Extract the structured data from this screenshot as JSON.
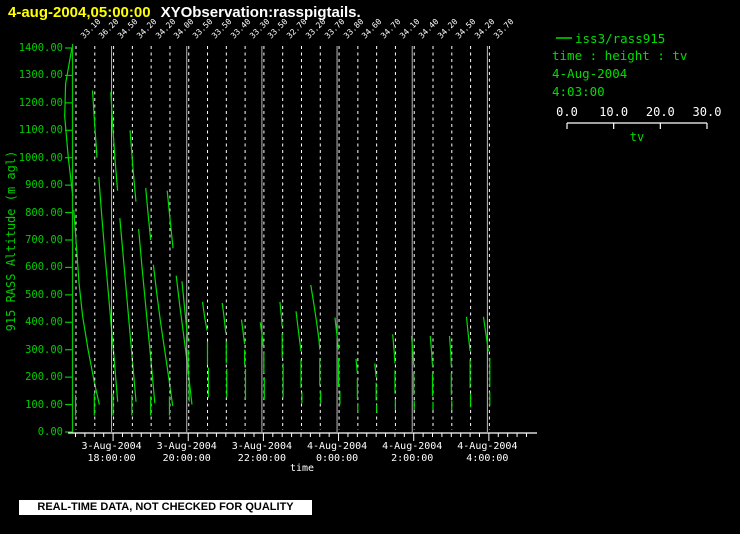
{
  "title": {
    "datetime": "4-aug-2004,05:00:00",
    "name": "XYObservation:rasspigtails."
  },
  "legend": {
    "series_label": "iss3/rass915",
    "relation": "time : height : tv",
    "date": "4-Aug-2004",
    "time": "4:03:00",
    "scale_labels": [
      "0.0",
      "10.0",
      "20.0",
      "30.0"
    ],
    "scale_title": "tv"
  },
  "footer": {
    "warning": "REAL-TIME DATA, NOT CHECKED FOR QUALITY"
  },
  "colors": {
    "background": "#000000",
    "title_datetime": "#ffff00",
    "title_name": "#ffffff",
    "series_green": "#00dd00",
    "axis_green": "#00cc00",
    "grid_gray": "#b8b8b8",
    "dashed_white": "#ffffff",
    "axis_white": "#ffffff",
    "banner_bg": "#ffffff",
    "banner_text": "#000000"
  },
  "chart_data": {
    "type": "line",
    "title": "XYObservation:rasspigtails.",
    "xlabel": "time",
    "ylabel": "915 RASS Altitude (m agl)",
    "ylim": [
      0,
      1400
    ],
    "y_ticks": [
      "1400.00",
      "1300.00",
      "1200.00",
      "1100.00",
      "1000.00",
      "900.00",
      "800.00",
      "700.00",
      "600.00",
      "500.00",
      "400.00",
      "300.00",
      "200.00",
      "100.00",
      "0.00"
    ],
    "x_major_ticks": [
      {
        "line1": "3-Aug-2004",
        "line2": "18:00:00"
      },
      {
        "line1": "3-Aug-2004",
        "line2": "20:00:00"
      },
      {
        "line1": "3-Aug-2004",
        "line2": "22:00:00"
      },
      {
        "line1": "4-Aug-2004",
        "line2": "0:00:00"
      },
      {
        "line1": "4-Aug-2004",
        "line2": "2:00:00"
      },
      {
        "line1": "4-Aug-2004",
        "line2": "4:00:00"
      }
    ],
    "tv_scale": {
      "labels": [
        "0.0",
        "10.0",
        "20.0",
        "30.0"
      ],
      "title": "tv",
      "range": [
        0,
        30
      ]
    },
    "series_note": "each profile: time of sounding, surface tv label shown at top of plot, segments of [tv_offset_units, altitude_m_agl]",
    "profiles": [
      {
        "time": "17:00",
        "label": "33.10",
        "segments": [
          [
            [
              -0.8,
              1400
            ],
            [
              -2.2,
              1270
            ],
            [
              -2.4,
              1150
            ],
            [
              -1.6,
              1000
            ],
            [
              -0.6,
              860
            ]
          ],
          [
            [
              -0.4,
              810
            ],
            [
              0.2,
              680
            ],
            [
              0.8,
              540
            ],
            [
              1.6,
              420
            ],
            [
              2.8,
              300
            ],
            [
              4.2,
              180
            ],
            [
              5.3,
              100
            ]
          ],
          [
            [
              0,
              135
            ],
            [
              0,
              60
            ]
          ]
        ]
      },
      {
        "time": "17:30",
        "label": "36.20",
        "segments": [
          [
            [
              -0.4,
              1245
            ],
            [
              0.1,
              1120
            ],
            [
              0.6,
              1000
            ]
          ],
          [
            [
              1.0,
              930
            ],
            [
              1.6,
              800
            ],
            [
              2.3,
              660
            ],
            [
              3.0,
              530
            ],
            [
              3.7,
              400
            ],
            [
              4.4,
              270
            ],
            [
              5.2,
              110
            ]
          ],
          [
            [
              0,
              140
            ],
            [
              0,
              60
            ]
          ]
        ]
      },
      {
        "time": "18:00",
        "label": "34.50",
        "segments": [
          [
            [
              -0.5,
              1240
            ],
            [
              -0.1,
              1120
            ],
            [
              0.4,
              1000
            ],
            [
              1.0,
              880
            ]
          ],
          [
            [
              1.5,
              780
            ],
            [
              2.2,
              650
            ],
            [
              2.9,
              520
            ],
            [
              3.6,
              390
            ],
            [
              4.3,
              260
            ],
            [
              5.1,
              110
            ]
          ],
          [
            [
              0,
              140
            ],
            [
              0,
              60
            ]
          ]
        ]
      },
      {
        "time": "18:30",
        "label": "34.20",
        "segments": [
          [
            [
              -0.4,
              1100
            ],
            [
              0.2,
              970
            ],
            [
              0.9,
              840
            ]
          ],
          [
            [
              1.5,
              740
            ],
            [
              2.2,
              610
            ],
            [
              2.9,
              490
            ],
            [
              3.6,
              370
            ],
            [
              4.3,
              250
            ],
            [
              5.1,
              105
            ]
          ],
          [
            [
              0,
              135
            ],
            [
              0,
              60
            ]
          ]
        ]
      },
      {
        "time": "19:00",
        "label": "34.20",
        "segments": [
          [
            [
              -1.1,
              890
            ],
            [
              -0.6,
              800
            ],
            [
              0,
              700
            ]
          ],
          [
            [
              0.6,
              610
            ],
            [
              1.4,
              500
            ],
            [
              2.2,
              400
            ],
            [
              3.1,
              300
            ],
            [
              4.0,
              200
            ],
            [
              4.9,
              95
            ]
          ],
          [
            [
              0,
              130
            ],
            [
              0,
              60
            ]
          ]
        ]
      },
      {
        "time": "19:30",
        "label": "34.00",
        "segments": [
          [
            [
              -0.5,
              880
            ],
            [
              0.1,
              780
            ],
            [
              0.8,
              670
            ]
          ],
          [
            [
              1.5,
              570
            ],
            [
              2.3,
              460
            ],
            [
              3.1,
              360
            ],
            [
              3.9,
              260
            ],
            [
              5.0,
              100
            ]
          ],
          [
            [
              0,
              130
            ],
            [
              0,
              60
            ]
          ]
        ]
      },
      {
        "time": "20:00",
        "label": "33.50",
        "segments": [
          [
            [
              -1.4,
              550
            ],
            [
              -0.8,
              450
            ],
            [
              -0.3,
              370
            ],
            [
              0,
              330
            ]
          ],
          [
            [
              0,
              300
            ],
            [
              0,
              210
            ]
          ],
          [
            [
              0.2,
              190
            ],
            [
              0.2,
              110
            ]
          ]
        ]
      },
      {
        "time": "20:30",
        "label": "33.50",
        "segments": [
          [
            [
              -1.0,
              474
            ],
            [
              -0.5,
              415
            ],
            [
              0,
              370
            ]
          ],
          [
            [
              0.1,
              330
            ],
            [
              0.1,
              245
            ]
          ],
          [
            [
              0.3,
              235
            ],
            [
              0.3,
              125
            ]
          ]
        ]
      },
      {
        "time": "21:00",
        "label": "33.40",
        "segments": [
          [
            [
              -0.8,
              470
            ],
            [
              -0.4,
              420
            ],
            [
              0,
              360
            ]
          ],
          [
            [
              0.1,
              330
            ],
            [
              0.1,
              250
            ]
          ],
          [
            [
              0.2,
              230
            ],
            [
              0.2,
              125
            ]
          ]
        ]
      },
      {
        "time": "21:30",
        "label": "33.30",
        "segments": [
          [
            [
              -0.7,
              410
            ],
            [
              -0.3,
              360
            ],
            [
              0,
              320
            ]
          ],
          [
            [
              0,
              300
            ],
            [
              0,
              245
            ]
          ],
          [
            [
              0.2,
              230
            ],
            [
              0.2,
              120
            ]
          ]
        ]
      },
      {
        "time": "22:00",
        "label": "33.50",
        "segments": [
          [
            [
              -0.7,
              400
            ],
            [
              -0.3,
              355
            ],
            [
              0,
              310
            ]
          ],
          [
            [
              0.1,
              290
            ],
            [
              0.1,
              215
            ]
          ],
          [
            [
              0.2,
              200
            ],
            [
              0.2,
              120
            ]
          ]
        ]
      },
      {
        "time": "22:30",
        "label": "32.70",
        "segments": [
          [
            [
              -0.5,
              474
            ],
            [
              -0.2,
              425
            ],
            [
              0,
              385
            ]
          ],
          [
            [
              0,
              360
            ],
            [
              0,
              270
            ]
          ],
          [
            [
              0.2,
              250
            ],
            [
              0.2,
              125
            ]
          ]
        ]
      },
      {
        "time": "23:00",
        "label": "33.20",
        "segments": [
          [
            [
              -1.1,
              440
            ],
            [
              -0.5,
              360
            ],
            [
              0,
              295
            ]
          ],
          [
            [
              0,
              265
            ],
            [
              0,
              160
            ]
          ],
          [
            [
              0.2,
              145
            ],
            [
              0.2,
              105
            ]
          ]
        ]
      },
      {
        "time": "23:30",
        "label": "33.70",
        "segments": [
          [
            [
              -2.0,
              536
            ],
            [
              -1.3,
              465
            ],
            [
              -0.7,
              400
            ],
            [
              -0.2,
              340
            ],
            [
              0,
              300
            ]
          ],
          [
            [
              0,
              270
            ],
            [
              0,
              170
            ]
          ],
          [
            [
              0.2,
              150
            ],
            [
              0.2,
              105
            ]
          ]
        ]
      },
      {
        "time": "0:00",
        "label": "33.80",
        "segments": [
          [
            [
              -0.8,
              417
            ],
            [
              -0.4,
              360
            ],
            [
              0,
              300
            ]
          ],
          [
            [
              0,
              270
            ],
            [
              0,
              165
            ]
          ],
          [
            [
              0.3,
              150
            ],
            [
              0.3,
              100
            ]
          ]
        ]
      },
      {
        "time": "0:30",
        "label": "34.60",
        "segments": [
          [
            [
              -0.3,
              267
            ],
            [
              0,
              215
            ]
          ],
          [
            [
              0,
              195
            ],
            [
              0,
              120
            ]
          ],
          [
            [
              0.1,
              105
            ],
            [
              0.1,
              70
            ]
          ]
        ]
      },
      {
        "time": "1:00",
        "label": "34.70",
        "segments": [
          [
            [
              -0.3,
              250
            ],
            [
              0,
              200
            ]
          ],
          [
            [
              0,
              180
            ],
            [
              0,
              115
            ]
          ],
          [
            [
              0.1,
              100
            ],
            [
              0.1,
              70
            ]
          ]
        ]
      },
      {
        "time": "1:30",
        "label": "34.10",
        "segments": [
          [
            [
              -0.5,
              356
            ],
            [
              -0.2,
              300
            ],
            [
              0,
              250
            ]
          ],
          [
            [
              0,
              225
            ],
            [
              0,
              140
            ]
          ],
          [
            [
              0.1,
              120
            ],
            [
              0.1,
              80
            ]
          ]
        ]
      },
      {
        "time": "2:00",
        "label": "34.40",
        "segments": [
          [
            [
              -0.5,
              350
            ],
            [
              -0.2,
              295
            ],
            [
              0,
              245
            ]
          ],
          [
            [
              0,
              220
            ],
            [
              0,
              135
            ]
          ],
          [
            [
              0.1,
              115
            ],
            [
              0.1,
              80
            ]
          ]
        ]
      },
      {
        "time": "2:30",
        "label": "34.20",
        "segments": [
          [
            [
              -0.5,
              350
            ],
            [
              -0.2,
              290
            ],
            [
              0,
              240
            ]
          ],
          [
            [
              0,
              215
            ],
            [
              0,
              130
            ]
          ],
          [
            [
              0.1,
              110
            ],
            [
              0.1,
              80
            ]
          ]
        ]
      },
      {
        "time": "3:00",
        "label": "34.50",
        "segments": [
          [
            [
              -0.4,
              350
            ],
            [
              -0.1,
              285
            ],
            [
              0,
              240
            ]
          ],
          [
            [
              0,
              215
            ],
            [
              0,
              135
            ]
          ],
          [
            [
              0.1,
              115
            ],
            [
              0.1,
              80
            ]
          ]
        ]
      },
      {
        "time": "3:30",
        "label": "34.20",
        "segments": [
          [
            [
              -0.8,
              420
            ],
            [
              -0.4,
              355
            ],
            [
              0,
              295
            ]
          ],
          [
            [
              0,
              265
            ],
            [
              0,
              160
            ]
          ],
          [
            [
              0.1,
              140
            ],
            [
              0.1,
              90
            ]
          ]
        ]
      },
      {
        "time": "4:00",
        "label": "33.70",
        "segments": [
          [
            [
              -1.2,
              420
            ],
            [
              -0.6,
              350
            ],
            [
              -0.1,
              295
            ]
          ],
          [
            [
              0.2,
              270
            ],
            [
              0.2,
              165
            ]
          ],
          [
            [
              0.2,
              145
            ],
            [
              0.2,
              95
            ]
          ]
        ]
      }
    ],
    "grid_profile_indices": [
      2,
      6,
      10,
      14,
      18,
      22
    ],
    "legend_position": "top-right"
  }
}
